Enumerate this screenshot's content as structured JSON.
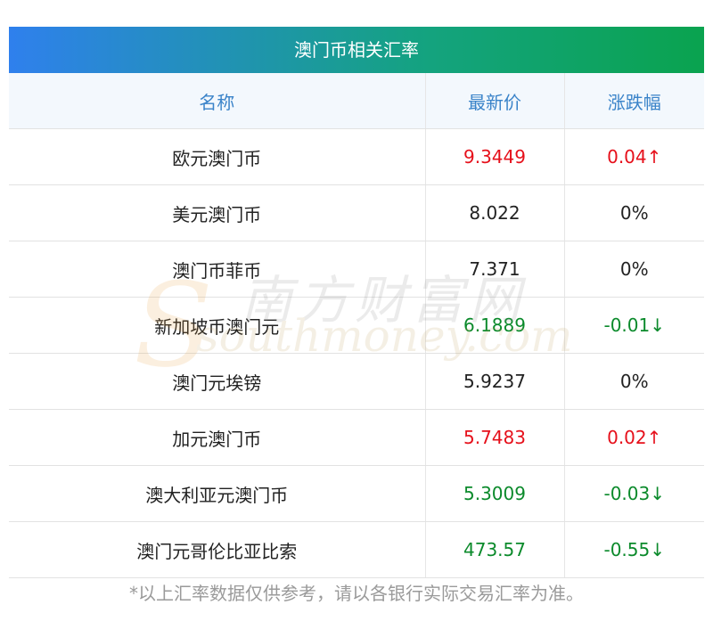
{
  "title": "澳门币相关汇率",
  "columns": [
    "名称",
    "最新价",
    "涨跌幅"
  ],
  "rows": [
    {
      "name": "欧元澳门币",
      "price": "9.3449",
      "change": "0.04↑",
      "trend": "up"
    },
    {
      "name": "美元澳门币",
      "price": "8.022",
      "change": "0%",
      "trend": "flat"
    },
    {
      "name": "澳门币菲币",
      "price": "7.371",
      "change": "0%",
      "trend": "flat"
    },
    {
      "name": "新加坡币澳门元",
      "price": "6.1889",
      "change": "-0.01↓",
      "trend": "down"
    },
    {
      "name": "澳门元埃镑",
      "price": "5.9237",
      "change": "0%",
      "trend": "flat"
    },
    {
      "name": "加元澳门币",
      "price": "5.7483",
      "change": "0.02↑",
      "trend": "up"
    },
    {
      "name": "澳大利亚元澳门币",
      "price": "5.3009",
      "change": "-0.03↓",
      "trend": "down"
    },
    {
      "name": "澳门元哥伦比亚比索",
      "price": "473.57",
      "change": "-0.55↓",
      "trend": "down"
    }
  ],
  "watermark": {
    "cn": "南方财富网",
    "en": "southmoney.com"
  },
  "footnote": "*以上汇率数据仅供参考，请以各银行实际交易汇率为准。",
  "colors": {
    "up": "#e6101b",
    "down": "#0b8a2b",
    "flat": "#222222",
    "header_text": "#3a83c9"
  }
}
